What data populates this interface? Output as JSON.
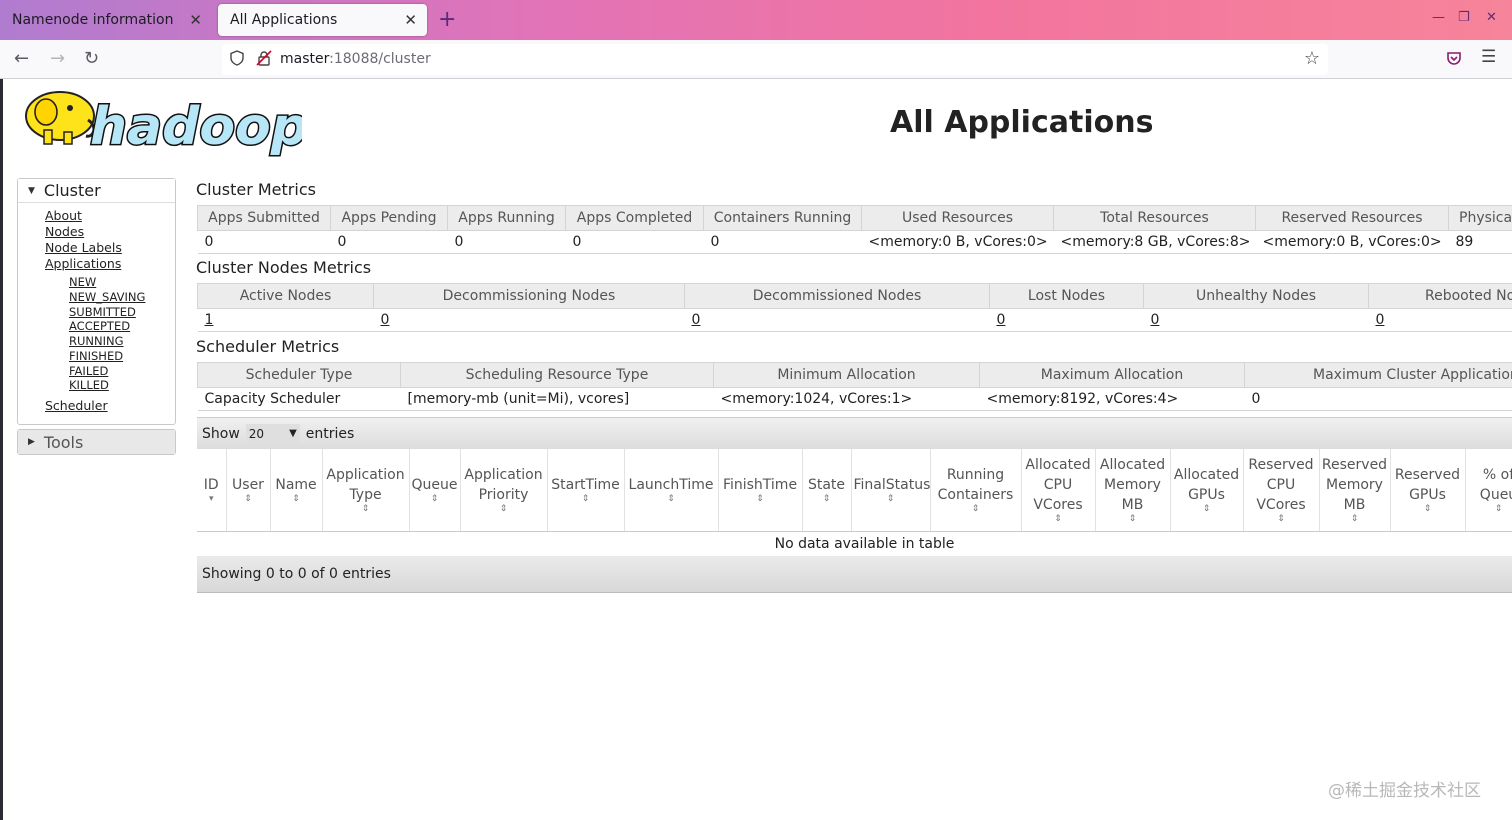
{
  "browser": {
    "tabs": [
      {
        "title": "Namenode information",
        "active": false
      },
      {
        "title": "All Applications",
        "active": true
      }
    ],
    "url_host": "master",
    "url_rest": ":18088/cluster",
    "icons": {
      "back": "arrow-left-icon",
      "forward": "arrow-right-icon",
      "reload": "reload-icon",
      "bookmark": "star-icon",
      "pocket": "pocket-icon",
      "menu": "hamburger-icon"
    }
  },
  "page": {
    "title": "All Applications",
    "logo_text": "hadoop"
  },
  "sidebar": {
    "cluster_label": "Cluster",
    "links": [
      "About",
      "Nodes",
      "Node Labels",
      "Applications"
    ],
    "app_states": [
      "NEW",
      "NEW_SAVING",
      "SUBMITTED",
      "ACCEPTED",
      "RUNNING",
      "FINISHED",
      "FAILED",
      "KILLED"
    ],
    "scheduler": "Scheduler",
    "tools_label": "Tools"
  },
  "cluster_metrics": {
    "title": "Cluster Metrics",
    "headers": [
      "Apps Submitted",
      "Apps Pending",
      "Apps Running",
      "Apps Completed",
      "Containers Running",
      "Used Resources",
      "Total Resources",
      "Reserved Resources",
      "Physica"
    ],
    "values": [
      "0",
      "0",
      "0",
      "0",
      "0",
      "<memory:0 B, vCores:0>",
      "<memory:8 GB, vCores:8>",
      "<memory:0 B, vCores:0>",
      "89"
    ]
  },
  "node_metrics": {
    "title": "Cluster Nodes Metrics",
    "headers": [
      "Active Nodes",
      "Decommissioning Nodes",
      "Decommissioned Nodes",
      "Lost Nodes",
      "Unhealthy Nodes",
      "Rebooted Noc"
    ],
    "values": [
      "1",
      "0",
      "0",
      "0",
      "0",
      "0"
    ]
  },
  "scheduler_metrics": {
    "title": "Scheduler Metrics",
    "headers": [
      "Scheduler Type",
      "Scheduling Resource Type",
      "Minimum Allocation",
      "Maximum Allocation",
      "Maximum Cluster Application P"
    ],
    "values": [
      "Capacity Scheduler",
      "[memory-mb (unit=Mi), vcores]",
      "<memory:1024, vCores:1>",
      "<memory:8192, vCores:4>",
      "0"
    ]
  },
  "apps_table": {
    "show_label": "Show",
    "page_size": "20",
    "entries_label": "entries",
    "columns": [
      {
        "l1": "ID",
        "l2": "",
        "l3": ""
      },
      {
        "l1": "User",
        "l2": "",
        "l3": ""
      },
      {
        "l1": "Name",
        "l2": "",
        "l3": ""
      },
      {
        "l1": "Application",
        "l2": "Type",
        "l3": ""
      },
      {
        "l1": "Queue",
        "l2": "",
        "l3": ""
      },
      {
        "l1": "Application",
        "l2": "Priority",
        "l3": ""
      },
      {
        "l1": "StartTime",
        "l2": "",
        "l3": ""
      },
      {
        "l1": "LaunchTime",
        "l2": "",
        "l3": ""
      },
      {
        "l1": "FinishTime",
        "l2": "",
        "l3": ""
      },
      {
        "l1": "State",
        "l2": "",
        "l3": ""
      },
      {
        "l1": "FinalStatus",
        "l2": "",
        "l3": ""
      },
      {
        "l1": "Running",
        "l2": "Containers",
        "l3": ""
      },
      {
        "l1": "Allocated",
        "l2": "CPU",
        "l3": "VCores"
      },
      {
        "l1": "Allocated",
        "l2": "Memory",
        "l3": "MB"
      },
      {
        "l1": "Allocated",
        "l2": "GPUs",
        "l3": ""
      },
      {
        "l1": "Reserved",
        "l2": "CPU",
        "l3": "VCores"
      },
      {
        "l1": "Reserved",
        "l2": "Memory",
        "l3": "MB"
      },
      {
        "l1": "Reserved",
        "l2": "GPUs",
        "l3": ""
      },
      {
        "l1": "% of",
        "l2": "Queu",
        "l3": ""
      }
    ],
    "empty_message": "No data available in table",
    "footer": "Showing 0 to 0 of 0 entries"
  },
  "watermark": "@稀土掘金技术社区"
}
